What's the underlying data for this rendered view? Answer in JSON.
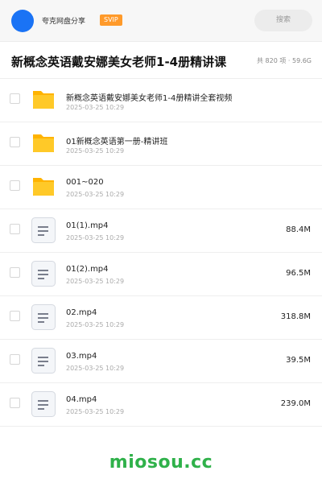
{
  "header": {
    "app_name": "夸克网盘分享",
    "badge": "SVIP",
    "search_label": "搜索"
  },
  "folder": {
    "title": "新概念英语戴安娜美女老师1-4册精讲课",
    "summary": "共 820 项 · 59.6G"
  },
  "items": [
    {
      "type": "folder",
      "name": "新概念英语戴安娜美女老师1-4册精讲全套视频",
      "date": "2025-03-25 10:29",
      "size": ""
    },
    {
      "type": "folder",
      "name": "01新概念英语第一册-精讲班",
      "date": "2025-03-25 10:29",
      "size": ""
    },
    {
      "type": "folder",
      "name": "001~020",
      "date": "2025-03-25 10:29",
      "size": ""
    },
    {
      "type": "file",
      "name": "01(1).mp4",
      "date": "2025-03-25 10:29",
      "size": "88.4M"
    },
    {
      "type": "file",
      "name": "01(2).mp4",
      "date": "2025-03-25 10:29",
      "size": "96.5M"
    },
    {
      "type": "file",
      "name": "02.mp4",
      "date": "2025-03-25 10:29",
      "size": "318.8M"
    },
    {
      "type": "file",
      "name": "03.mp4",
      "date": "2025-03-25 10:29",
      "size": "39.5M"
    },
    {
      "type": "file",
      "name": "04.mp4",
      "date": "2025-03-25 10:29",
      "size": "239.0M"
    }
  ],
  "watermark": "miosou.cc",
  "colors": {
    "avatar": "#1a73f5",
    "badge": "#ff9a2a",
    "folder": "#ffc928",
    "watermark": "#2fb14a"
  },
  "icons": {
    "folder": "folder-icon",
    "file": "document-icon"
  }
}
